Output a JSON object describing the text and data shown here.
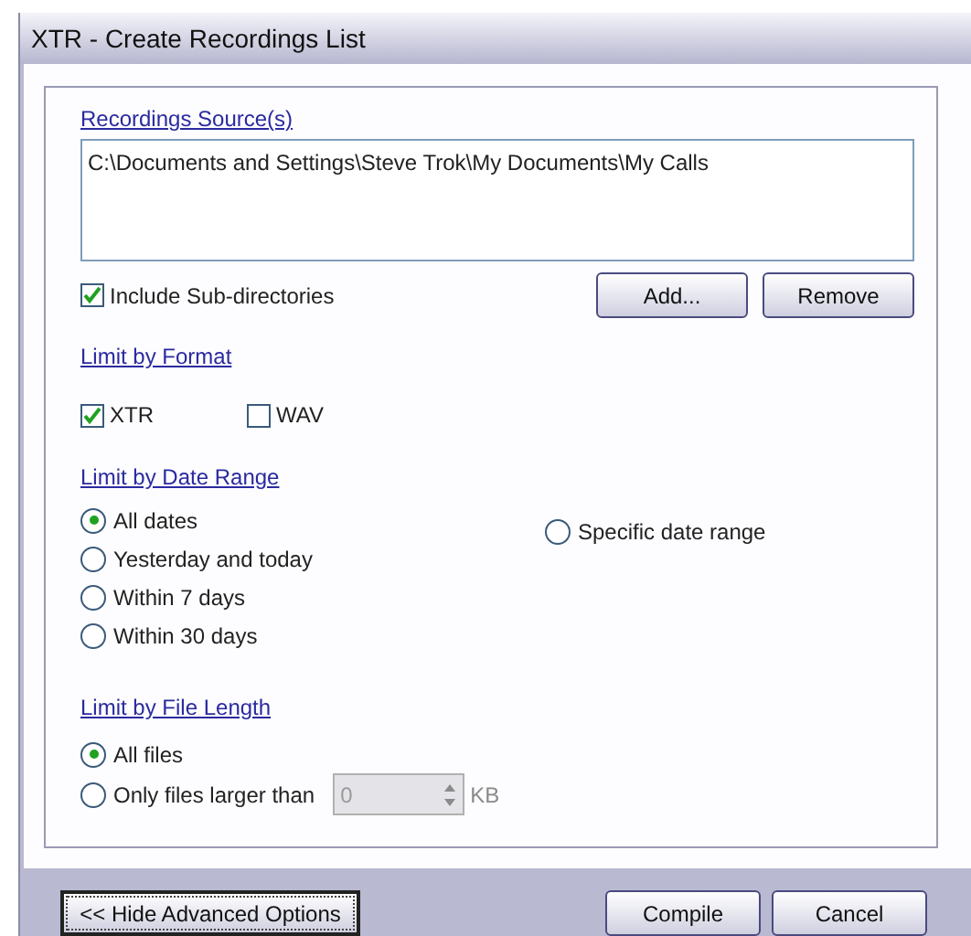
{
  "window": {
    "title": "XTR - Create Recordings List"
  },
  "sources": {
    "heading": "Recordings Source(s)",
    "items": [
      "C:\\Documents and Settings\\Steve Trok\\My Documents\\My Calls"
    ],
    "include_subdirectories": {
      "label": "Include Sub-directories",
      "checked": true
    },
    "buttons": [
      "Add...",
      "Remove"
    ]
  },
  "format": {
    "heading": "Limit by Format",
    "options": [
      {
        "label": "XTR",
        "checked": true
      },
      {
        "label": "WAV",
        "checked": false
      }
    ]
  },
  "date_range": {
    "heading": "Limit by Date Range",
    "options": [
      {
        "label": "All dates",
        "selected": true
      },
      {
        "label": "Yesterday and today",
        "selected": false
      },
      {
        "label": "Within 7 days",
        "selected": false
      },
      {
        "label": "Within 30 days",
        "selected": false
      },
      {
        "label": "Specific date range",
        "selected": false
      }
    ]
  },
  "file_length": {
    "heading": "Limit by File Length",
    "options": [
      {
        "label": "All files",
        "selected": true
      },
      {
        "label": "Only files larger than",
        "selected": false
      }
    ],
    "size_field": {
      "value": "0",
      "unit": "KB",
      "disabled": true
    }
  },
  "footer": {
    "toggle_button": "<< Hide Advanced Options",
    "buttons": [
      "Compile",
      "Cancel"
    ]
  }
}
